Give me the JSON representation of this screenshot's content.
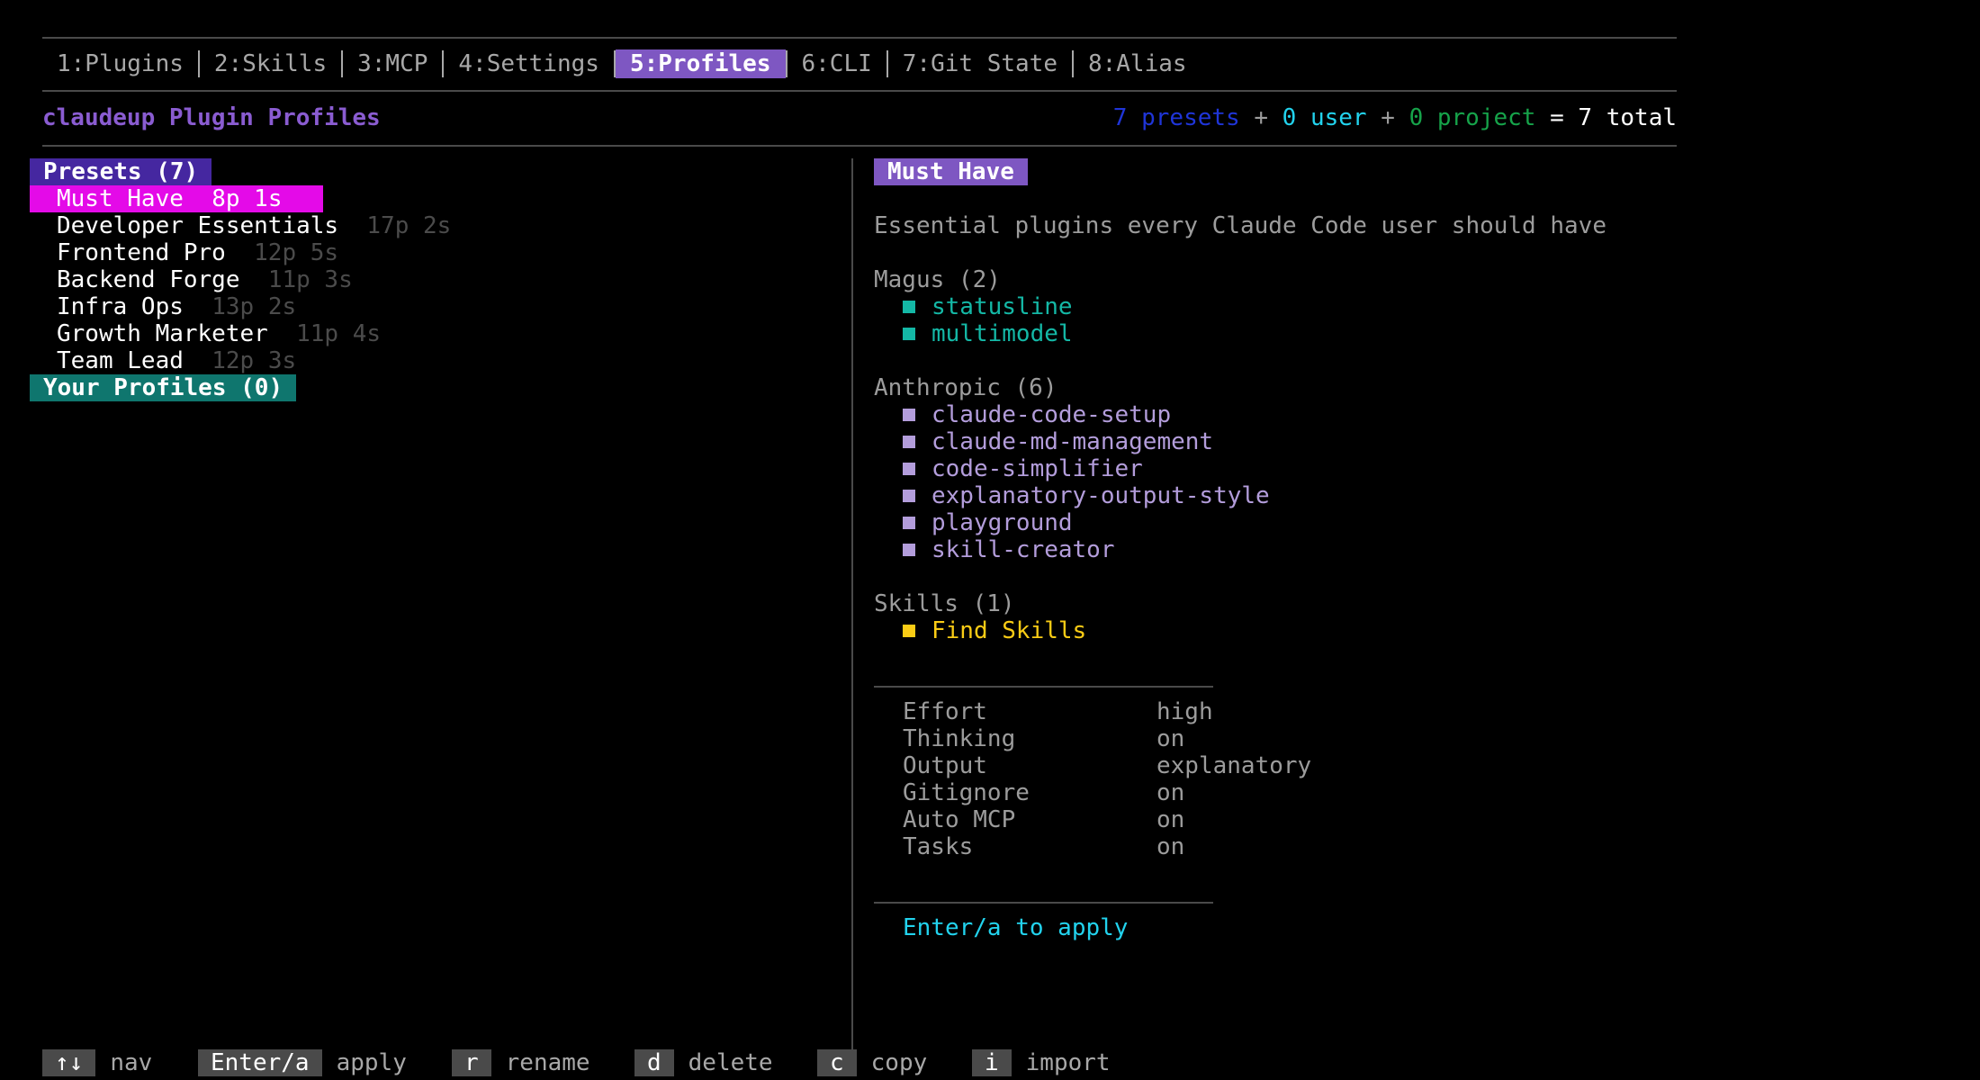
{
  "tabs": [
    {
      "label": "1:Plugins",
      "active": false
    },
    {
      "label": "2:Skills",
      "active": false
    },
    {
      "label": "3:MCP",
      "active": false
    },
    {
      "label": "4:Settings",
      "active": false
    },
    {
      "label": "5:Profiles",
      "active": true
    },
    {
      "label": "6:CLI",
      "active": false
    },
    {
      "label": "7:Git State",
      "active": false
    },
    {
      "label": "8:Alias",
      "active": false
    }
  ],
  "header": {
    "title": "claudeup Plugin Profiles",
    "presets_count": "7",
    "presets_label": " presets",
    "plus1": " + ",
    "user_count": "0",
    "user_label": " user",
    "plus2": " + ",
    "project_count": "0",
    "project_label": " project",
    "equals": " = ",
    "total": "7 total"
  },
  "left": {
    "presets_header": "Presets (7)",
    "presets": [
      {
        "name": "Must Have",
        "meta": "8p 1s",
        "selected": true
      },
      {
        "name": "Developer Essentials",
        "meta": "17p 2s"
      },
      {
        "name": "Frontend Pro",
        "meta": "12p 5s"
      },
      {
        "name": "Backend Forge",
        "meta": "11p 3s"
      },
      {
        "name": "Infra Ops",
        "meta": "13p 2s"
      },
      {
        "name": "Growth Marketer",
        "meta": "11p 4s"
      },
      {
        "name": "Team Lead",
        "meta": "12p 3s"
      }
    ],
    "profiles_header": "Your Profiles (0)"
  },
  "detail": {
    "title": "Must Have",
    "description": "Essential plugins every Claude Code user should have",
    "groups": [
      {
        "label": "Magus (2)",
        "color": "teal",
        "items": [
          "statusline",
          "multimodel"
        ]
      },
      {
        "label": "Anthropic (6)",
        "color": "lav",
        "items": [
          "claude-code-setup",
          "claude-md-management",
          "code-simplifier",
          "explanatory-output-style",
          "playground",
          "skill-creator"
        ]
      },
      {
        "label": "Skills (1)",
        "color": "yel",
        "items": [
          "Find Skills"
        ]
      }
    ],
    "settings": [
      {
        "k": "Effort",
        "v": "high"
      },
      {
        "k": "Thinking",
        "v": "on"
      },
      {
        "k": "Output",
        "v": "explanatory"
      },
      {
        "k": "Gitignore",
        "v": "on"
      },
      {
        "k": "Auto MCP",
        "v": "on"
      },
      {
        "k": "Tasks",
        "v": "on"
      }
    ],
    "apply_hint": "Enter/a to apply"
  },
  "footer": [
    {
      "key": "↑↓",
      "label": "nav"
    },
    {
      "key": "Enter/a",
      "label": "apply"
    },
    {
      "key": "r",
      "label": "rename"
    },
    {
      "key": "d",
      "label": "delete"
    },
    {
      "key": "c",
      "label": "copy"
    },
    {
      "key": "i",
      "label": "import"
    }
  ],
  "colors": {
    "accent": "#7e57c2",
    "selected_row": "#e40ae8",
    "profiles_header": "#0f766e",
    "magus": "#14b8a6",
    "anthropic": "#b39ddb",
    "skills": "#facc15",
    "hint": "#22d3ee"
  }
}
